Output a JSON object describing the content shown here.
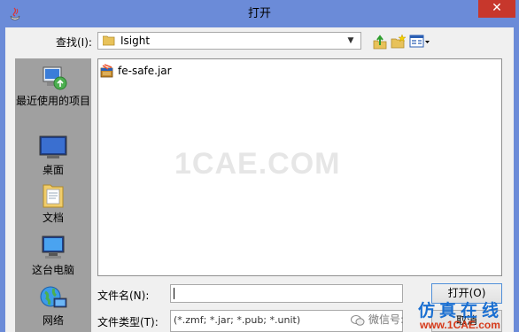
{
  "window": {
    "title": "打开",
    "close_symbol": "✕"
  },
  "lookin": {
    "label": "查找(I):",
    "value": "Isight"
  },
  "places": [
    {
      "label": "最近使用的项目",
      "icon": "recent-places-icon"
    },
    {
      "label": "桌面",
      "icon": "desktop-icon"
    },
    {
      "label": "文档",
      "icon": "documents-folder-icon"
    },
    {
      "label": "这台电脑",
      "icon": "computer-icon"
    },
    {
      "label": "网络",
      "icon": "network-icon"
    }
  ],
  "files": [
    {
      "name": "fe-safe.jar",
      "icon": "jar-file-icon"
    }
  ],
  "watermark": "1CAE.COM",
  "filename": {
    "label": "文件名(N):",
    "value": ""
  },
  "filetype": {
    "label": "文件类型(T):",
    "value": "(*.zmf; *.jar; *.pub; *.unit)"
  },
  "buttons": {
    "open": "打开(O)",
    "cancel": "取消"
  },
  "overlay": {
    "wechat": "微信号:",
    "brand": "仿真在线",
    "brand_url": "www.1CAE.com"
  },
  "colors": {
    "titlebar": "#6b8bd8",
    "close": "#c7372c",
    "places_bg": "#a0a0a0"
  }
}
